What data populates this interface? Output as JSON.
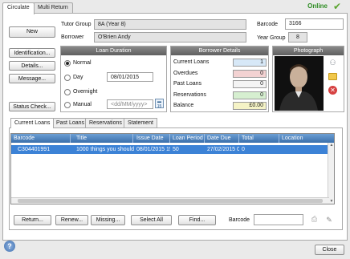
{
  "tabs": [
    "Circulate",
    "Multi Return"
  ],
  "status": {
    "text": "Online",
    "color": "#2f8d24"
  },
  "left_buttons": {
    "new": "New",
    "identification": "Identification...",
    "details": "Details...",
    "message": "Message...",
    "status_check": "Status Check..."
  },
  "borrower": {
    "tutor_group_label": "Tutor Group",
    "tutor_group_value": "8A (Year 8)",
    "borrower_label": "Borrower",
    "borrower_value": "O'Brien Andy",
    "barcode_label": "Barcode",
    "barcode_value": "3166",
    "year_group_label": "Year Group",
    "year_group_value": "8"
  },
  "loan_duration": {
    "title": "Loan Duration",
    "options": [
      "Normal",
      "Day",
      "Overnight",
      "Manual"
    ],
    "selected": "Normal",
    "day_value": "08/01/2015",
    "manual_placeholder": "<dd/MM/yyyy>"
  },
  "borrower_details": {
    "title": "Borrower Details",
    "rows": [
      {
        "label": "Current Loans",
        "value": "1",
        "color": "#d7e8f7"
      },
      {
        "label": "Overdues",
        "value": "0",
        "color": "#f3d2d2"
      },
      {
        "label": "Past Loans",
        "value": "0",
        "color": "#f4f4f4"
      },
      {
        "label": "Reservations",
        "value": "0",
        "color": "#d6efd0"
      },
      {
        "label": "Balance",
        "value": "£0.00",
        "color": "#f5f3c6"
      }
    ]
  },
  "photograph": {
    "title": "Photograph"
  },
  "sub_tabs": [
    "Current Loans",
    "Past Loans",
    "Reservations",
    "Statement"
  ],
  "loans_grid": {
    "columns": [
      "Barcode",
      "Title",
      "Issue Date",
      "Loan Period",
      "Date Due",
      "Total Renewals",
      "Location"
    ],
    "rows": [
      [
        "C304401991",
        "1000 things you should k",
        "08/01/2015 15",
        "50",
        "27/02/2015 0(",
        "0",
        ""
      ]
    ]
  },
  "bottom_buttons": {
    "return": "Return...",
    "renew": "Renew...",
    "missing": "Missing...",
    "select_all": "Select All",
    "find": "Find..."
  },
  "bottom_barcode_label": "Barcode",
  "footer": {
    "close": "Close"
  }
}
